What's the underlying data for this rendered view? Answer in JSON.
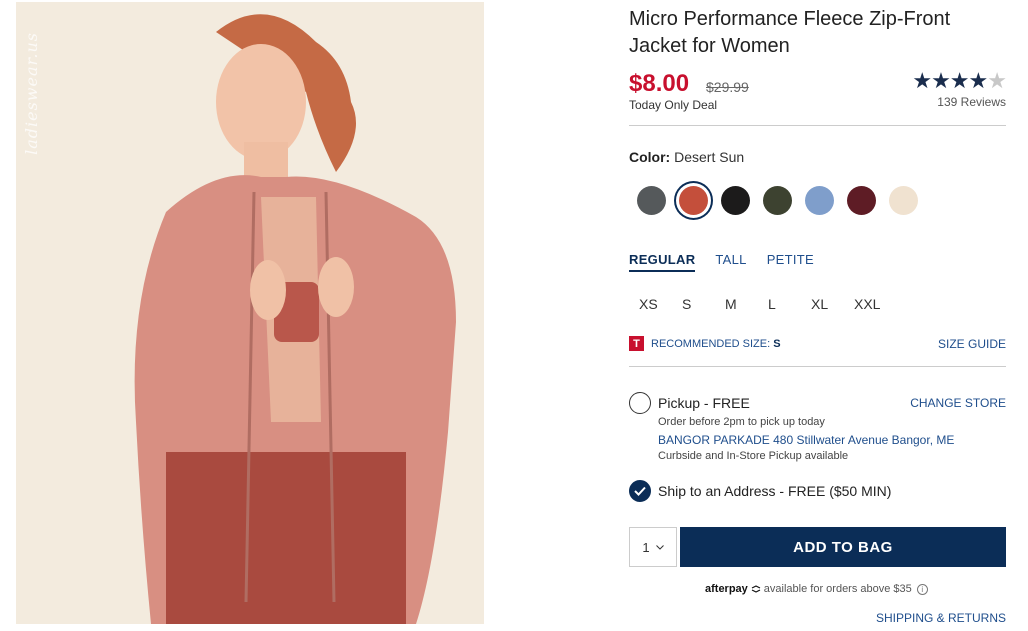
{
  "product": {
    "title": "Micro Performance Fleece Zip-Front Jacket for Women",
    "price": "$8.00",
    "original_price": "$29.99",
    "deal_text": "Today Only Deal",
    "rating_stars": 4,
    "rating_max": 5,
    "reviews": "139 Reviews",
    "image_watermark": "ladieswear.us"
  },
  "color": {
    "label": "Color:",
    "selected": "Desert Sun",
    "swatches": [
      {
        "color": "#55595b"
      },
      {
        "color": "#c44f3b",
        "selected": true
      },
      {
        "color": "#1c1b1b"
      },
      {
        "color": "#3d4230"
      },
      {
        "color": "#7f9ecb"
      },
      {
        "color": "#5e1c25"
      },
      {
        "color": "#f0e2d0"
      }
    ]
  },
  "fit_tabs": [
    {
      "label": "REGULAR",
      "active": true
    },
    {
      "label": "TALL"
    },
    {
      "label": "PETITE"
    }
  ],
  "sizes": [
    "XS",
    "S",
    "M",
    "L",
    "XL",
    "XXL"
  ],
  "recommendation": {
    "badge": "T",
    "label": "RECOMMENDED SIZE:",
    "size": "S",
    "size_guide": "SIZE GUIDE"
  },
  "fulfillment": {
    "pickup_label": "Pickup - FREE",
    "change_store": "CHANGE STORE",
    "pickup_note": "Order before 2pm to pick up today",
    "store": "BANGOR PARKADE 480 Stillwater Avenue  Bangor, ME",
    "pickup_availability": "Curbside and In-Store Pickup available",
    "ship_label": "Ship to an Address - FREE ($50 MIN)"
  },
  "cart": {
    "quantity": "1",
    "add_to_bag": "ADD TO BAG"
  },
  "afterpay": {
    "logo": "afterpay",
    "text": "available for orders above $35"
  },
  "footer": {
    "shipping_returns": "SHIPPING & RETURNS"
  },
  "colors": {
    "price_red": "#c8102e",
    "navy": "#0b2d57",
    "link_blue": "#1f4e8c"
  }
}
